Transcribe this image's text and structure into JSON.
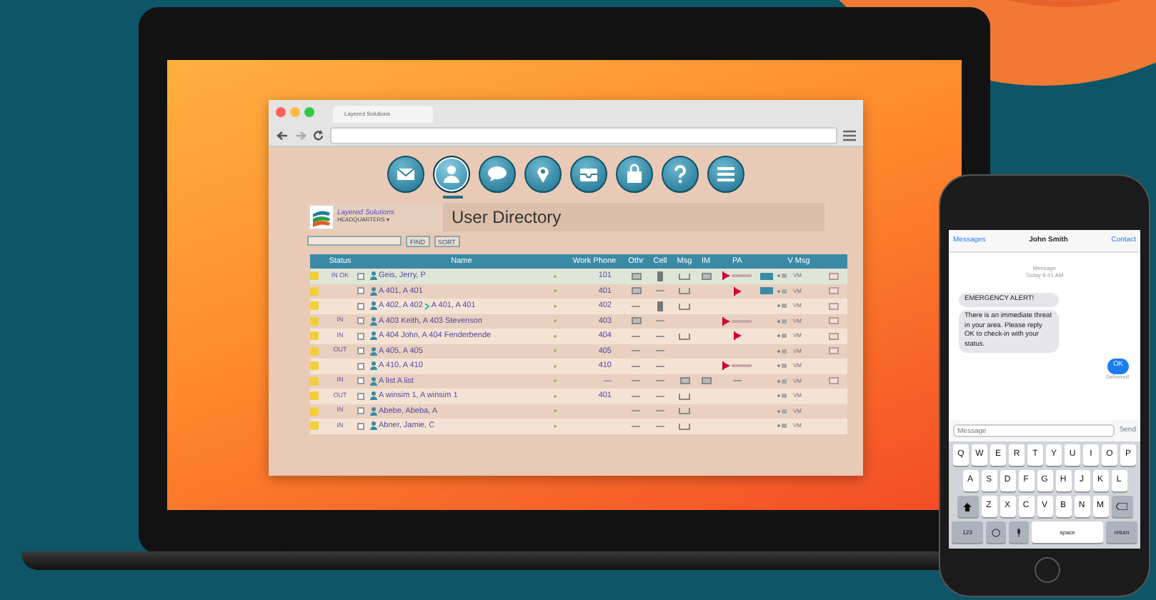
{
  "browser": {
    "tab_title": "Layered Solutions"
  },
  "toolbar": [
    {
      "kind": "mail",
      "selected": false
    },
    {
      "kind": "person",
      "selected": true
    },
    {
      "kind": "chat",
      "selected": false
    },
    {
      "kind": "pin",
      "selected": false
    },
    {
      "kind": "tray",
      "selected": false
    },
    {
      "kind": "bag",
      "selected": false
    },
    {
      "kind": "help",
      "selected": false
    },
    {
      "kind": "menu",
      "selected": false
    }
  ],
  "header": {
    "company": "Layered Solutions",
    "location": "HEADQUARTERS ▾",
    "title": "User Directory"
  },
  "search": {
    "buttons": [
      "FIND",
      "SORT"
    ]
  },
  "table": {
    "columns": [
      "Status",
      "Name",
      "Work Phone",
      "Othr",
      "Cell",
      "Msg",
      "IM",
      "PA",
      "V Msg"
    ],
    "rows": [
      {
        "status": "IN OK",
        "name": "Geis, Jerry, P",
        "phone": "101",
        "icons": [
          {
            "kind": "device"
          },
          {
            "kind": "phone"
          },
          {
            "kind": "tray"
          },
          {
            "kind": "device"
          },
          {
            "kind": "flag-bar"
          }
        ],
        "badge": true,
        "vm": "VM",
        "envelope": true,
        "selected": true
      },
      {
        "name": "A 401, A 401",
        "phone": "401",
        "icons": [
          {
            "kind": "device"
          },
          {
            "kind": "dash"
          },
          {
            "kind": "tray"
          },
          {
            "kind": "none"
          },
          {
            "kind": "flag"
          }
        ],
        "badge": true,
        "vm": "VM",
        "envelope": true,
        "selected": false
      },
      {
        "name": "A 402, A 402",
        "forward": "A 401, A 401",
        "phone": "402",
        "icons": [
          {
            "kind": "dash"
          },
          {
            "kind": "phone"
          },
          {
            "kind": "tray"
          },
          {
            "kind": "none"
          },
          {
            "kind": "none"
          }
        ],
        "badge": false,
        "vm": "VM",
        "envelope": true,
        "selected": false
      },
      {
        "status": "IN",
        "name": "A 403 Keith, A 403 Stevenson",
        "phone": "403",
        "icons": [
          {
            "kind": "device"
          },
          {
            "kind": "dash"
          },
          {
            "kind": "none"
          },
          {
            "kind": "none"
          },
          {
            "kind": "flag-bar"
          }
        ],
        "badge": false,
        "vm": "VM",
        "envelope": true,
        "selected": false
      },
      {
        "status": "IN",
        "name": "A 404 John, A 404 Fenderbende",
        "phone": "404",
        "icons": [
          {
            "kind": "dash"
          },
          {
            "kind": "dash"
          },
          {
            "kind": "tray"
          },
          {
            "kind": "none"
          },
          {
            "kind": "flag"
          }
        ],
        "badge": false,
        "vm": "VM",
        "envelope": true,
        "selected": false
      },
      {
        "status": "OUT",
        "name": "A 405, A 405",
        "phone": "405",
        "icons": [
          {
            "kind": "dash"
          },
          {
            "kind": "dash"
          },
          {
            "kind": "none"
          },
          {
            "kind": "none"
          },
          {
            "kind": "none"
          }
        ],
        "badge": false,
        "vm": "VM",
        "envelope": true,
        "selected": false
      },
      {
        "name": "A 410, A 410",
        "phone": "410",
        "icons": [
          {
            "kind": "dash"
          },
          {
            "kind": "dash"
          },
          {
            "kind": "none"
          },
          {
            "kind": "none"
          },
          {
            "kind": "flag-bar"
          }
        ],
        "badge": false,
        "vm": "VM",
        "envelope": false,
        "selected": false
      },
      {
        "status": "IN",
        "name": "A list A list",
        "phone": "—",
        "icons": [
          {
            "kind": "dash"
          },
          {
            "kind": "dash"
          },
          {
            "kind": "device"
          },
          {
            "kind": "device"
          },
          {
            "kind": "dash"
          }
        ],
        "badge": false,
        "vm": "VM",
        "envelope": true,
        "selected": false
      },
      {
        "status": "OUT",
        "name": "A winsim 1, A winsim 1",
        "phone": "401",
        "icons": [
          {
            "kind": "dash"
          },
          {
            "kind": "dash"
          },
          {
            "kind": "tray"
          },
          {
            "kind": "none"
          },
          {
            "kind": "none"
          }
        ],
        "badge": false,
        "vm": "VM",
        "envelope": false,
        "selected": false
      },
      {
        "status": "IN",
        "name": "Abebe, Abeba, A",
        "icons": [
          {
            "kind": "dash"
          },
          {
            "kind": "dash"
          },
          {
            "kind": "tray"
          },
          {
            "kind": "none"
          },
          {
            "kind": "none"
          }
        ],
        "badge": false,
        "vm": "VM",
        "envelope": false,
        "selected": false
      },
      {
        "status": "IN",
        "name": "Abner, Jamie, C",
        "icons": [
          {
            "kind": "dash"
          },
          {
            "kind": "dash"
          },
          {
            "kind": "tray"
          },
          {
            "kind": "none"
          },
          {
            "kind": "none"
          }
        ],
        "badge": false,
        "vm": "VM",
        "envelope": false,
        "selected": false
      }
    ]
  },
  "phone": {
    "back": "Messages",
    "contact_name": "John Smith",
    "contact_link": "Contact",
    "service": "Message",
    "time": "Today 9:41 AM",
    "messages": [
      {
        "kind": "received",
        "text": "EMERGENCY ALERT!"
      },
      {
        "kind": "received",
        "text": "There is an immediate threat in your area. Please reply OK to check-in with your status."
      },
      {
        "kind": "sent",
        "text": "OK"
      }
    ],
    "receipt": "Delivered",
    "placeholder": "Message",
    "send": "Send",
    "keyboard": [
      [
        {
          "kind": "key",
          "label": "Q"
        },
        {
          "kind": "key",
          "label": "W"
        },
        {
          "kind": "key",
          "label": "E"
        },
        {
          "kind": "key",
          "label": "R"
        },
        {
          "kind": "key",
          "label": "T"
        },
        {
          "kind": "key",
          "label": "Y"
        },
        {
          "kind": "key",
          "label": "U"
        },
        {
          "kind": "key",
          "label": "I"
        },
        {
          "kind": "key",
          "label": "O"
        },
        {
          "kind": "key",
          "label": "P"
        }
      ],
      [
        {
          "kind": "key",
          "label": "A"
        },
        {
          "kind": "key",
          "label": "S"
        },
        {
          "kind": "key",
          "label": "D"
        },
        {
          "kind": "key",
          "label": "F"
        },
        {
          "kind": "key",
          "label": "G"
        },
        {
          "kind": "key",
          "label": "H"
        },
        {
          "kind": "key",
          "label": "J"
        },
        {
          "kind": "key",
          "label": "K"
        },
        {
          "kind": "key",
          "label": "L"
        }
      ],
      [
        {
          "kind": "shift"
        },
        {
          "kind": "key",
          "label": "Z"
        },
        {
          "kind": "key",
          "label": "X"
        },
        {
          "kind": "key",
          "label": "C"
        },
        {
          "kind": "key",
          "label": "V"
        },
        {
          "kind": "key",
          "label": "B"
        },
        {
          "kind": "key",
          "label": "N"
        },
        {
          "kind": "key",
          "label": "M"
        },
        {
          "kind": "delete"
        }
      ],
      [
        {
          "kind": "mod",
          "label": "123"
        },
        {
          "kind": "emoji"
        },
        {
          "kind": "mic"
        },
        {
          "kind": "space",
          "label": "space"
        },
        {
          "kind": "mod",
          "label": "return"
        }
      ]
    ]
  }
}
